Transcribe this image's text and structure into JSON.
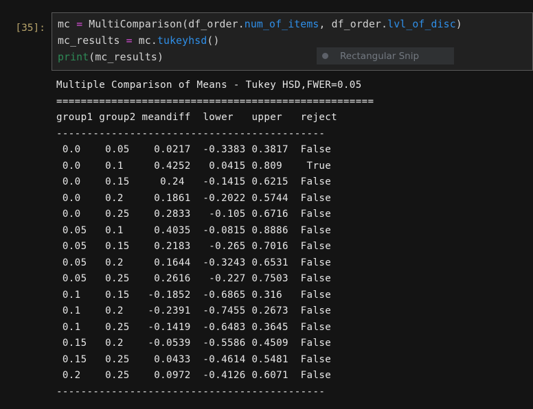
{
  "cell": {
    "prompt": "[35]:",
    "code_lines": [
      [
        {
          "t": "mc ",
          "c": "plain"
        },
        {
          "t": "=",
          "c": "op"
        },
        {
          "t": " MultiComparison(df_order.",
          "c": "plain"
        },
        {
          "t": "num_of_items",
          "c": "attr"
        },
        {
          "t": ", df_order.",
          "c": "plain"
        },
        {
          "t": "lvl_of_disc",
          "c": "attr"
        },
        {
          "t": ")",
          "c": "plain"
        }
      ],
      [
        {
          "t": "mc_results ",
          "c": "plain"
        },
        {
          "t": "=",
          "c": "op"
        },
        {
          "t": " mc.",
          "c": "plain"
        },
        {
          "t": "tukeyhsd",
          "c": "attr"
        },
        {
          "t": "()",
          "c": "plain"
        }
      ],
      [
        {
          "t": "print",
          "c": "builtin"
        },
        {
          "t": "(mc_results)",
          "c": "plain"
        }
      ]
    ]
  },
  "snip_overlay": {
    "label": "Rectangular Snip",
    "icon": "record-dot-icon"
  },
  "output": {
    "title": "Multiple Comparison of Means - Tukey HSD,FWER=0.05",
    "rule_top": "====================================================",
    "header": "group1 group2 meandiff  lower   upper   reject",
    "rule_header": "--------------------------------------------",
    "rows": [
      " 0.0    0.05    0.0217  -0.3383 0.3817  False ",
      " 0.0    0.1     0.4252   0.0415 0.809    True ",
      " 0.0    0.15     0.24   -0.1415 0.6215  False ",
      " 0.0    0.2     0.1861  -0.2022 0.5744  False ",
      " 0.0    0.25    0.2833   -0.105 0.6716  False ",
      " 0.05   0.1     0.4035  -0.0815 0.8886  False ",
      " 0.05   0.15    0.2183   -0.265 0.7016  False ",
      " 0.05   0.2     0.1644  -0.3243 0.6531  False ",
      " 0.05   0.25    0.2616   -0.227 0.7503  False ",
      " 0.1    0.15   -0.1852  -0.6865 0.316   False ",
      " 0.1    0.2    -0.2391  -0.7455 0.2673  False ",
      " 0.1    0.25   -0.1419  -0.6483 0.3645  False ",
      " 0.15   0.2    -0.0539  -0.5586 0.4509  False ",
      " 0.15   0.25    0.0433  -0.4614 0.5481  False ",
      " 0.2    0.25    0.0972  -0.4126 0.6071  False "
    ],
    "rule_bottom": "--------------------------------------------"
  },
  "colors": {
    "page_background": "#141414",
    "cell_background": "#212121",
    "cell_border": "#5a5a5a",
    "prompt_text": "#b6a36a",
    "code_text": "#d4d4d4",
    "operator": "#d94fd9",
    "attribute": "#2f8fe8",
    "builtin": "#2e8b57",
    "output_text": "#e8e8e8"
  }
}
